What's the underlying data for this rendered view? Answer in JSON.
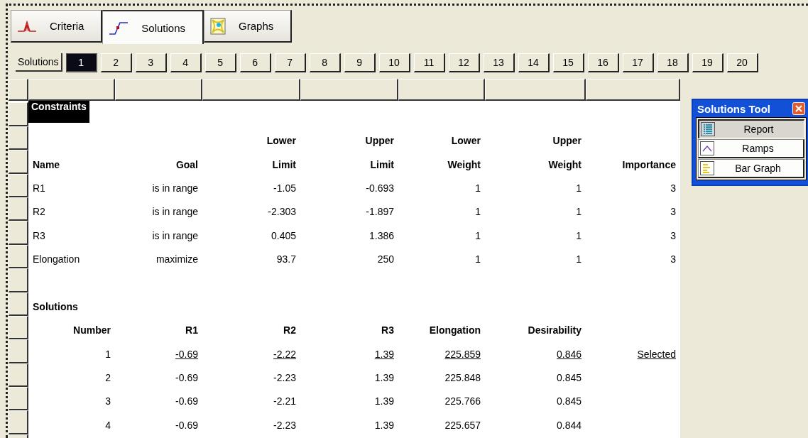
{
  "tabs": [
    {
      "label": "Criteria",
      "kind": "peak",
      "selected": false
    },
    {
      "label": "Solutions",
      "kind": "ramp",
      "selected": true
    },
    {
      "label": "Graphs",
      "kind": "map",
      "selected": false
    }
  ],
  "solution_selector": {
    "label": "Solutions",
    "numbers": [
      {
        "label": "1",
        "selected": true
      },
      {
        "label": "2",
        "selected": false
      },
      {
        "label": "3",
        "selected": false
      },
      {
        "label": "4",
        "selected": false
      },
      {
        "label": "5",
        "selected": false
      },
      {
        "label": "6",
        "selected": false
      },
      {
        "label": "7",
        "selected": false
      },
      {
        "label": "8",
        "selected": false
      },
      {
        "label": "9",
        "selected": false
      },
      {
        "label": "10",
        "selected": false
      },
      {
        "label": "11",
        "selected": false
      },
      {
        "label": "12",
        "selected": false
      },
      {
        "label": "13",
        "selected": false
      },
      {
        "label": "14",
        "selected": false
      },
      {
        "label": "15",
        "selected": false
      },
      {
        "label": "16",
        "selected": false
      },
      {
        "label": "17",
        "selected": false
      },
      {
        "label": "18",
        "selected": false
      },
      {
        "label": "19",
        "selected": false
      },
      {
        "label": "20",
        "selected": false
      }
    ]
  },
  "report": {
    "constraints": {
      "title": "Constraints",
      "columns": [
        {
          "label": "Name"
        },
        {
          "label": "Goal"
        },
        {
          "top": "Lower",
          "label": "Limit"
        },
        {
          "top": "Upper",
          "label": "Limit"
        },
        {
          "top": "Lower",
          "label": "Weight"
        },
        {
          "top": "Upper",
          "label": "Weight"
        },
        {
          "label": "Importance"
        }
      ],
      "rows": [
        [
          "R1",
          "is in range",
          "-1.05",
          "-0.693",
          "1",
          "1",
          "3"
        ],
        [
          "R2",
          "is in range",
          "-2.303",
          "-1.897",
          "1",
          "1",
          "3"
        ],
        [
          "R3",
          "is in range",
          "0.405",
          "1.386",
          "1",
          "1",
          "3"
        ],
        [
          "Elongation",
          "maximize",
          "93.7",
          "250",
          "1",
          "1",
          "3"
        ]
      ]
    },
    "solutions": {
      "title": "Solutions",
      "columns": [
        "Number",
        "R1",
        "R2",
        "R3",
        "Elongation",
        "Desirability"
      ],
      "rows": [
        {
          "values": [
            "1",
            "-0.69",
            "-2.22",
            "1.39",
            "225.859",
            "0.846"
          ],
          "selected": true,
          "status": "Selected"
        },
        {
          "values": [
            "2",
            "-0.69",
            "-2.23",
            "1.39",
            "225.848",
            "0.845"
          ],
          "selected": false
        },
        {
          "values": [
            "3",
            "-0.69",
            "-2.21",
            "1.39",
            "225.766",
            "0.845"
          ],
          "selected": false
        },
        {
          "values": [
            "4",
            "-0.69",
            "-2.23",
            "1.39",
            "225.657",
            "0.844"
          ],
          "selected": false
        }
      ]
    }
  },
  "tool_window": {
    "title": "Solutions Tool",
    "items": [
      {
        "label": "Report",
        "kind": "list",
        "selected": true
      },
      {
        "label": "Ramps",
        "kind": "ramp",
        "selected": false
      },
      {
        "label": "Bar Graph",
        "kind": "bars",
        "selected": false
      }
    ]
  }
}
